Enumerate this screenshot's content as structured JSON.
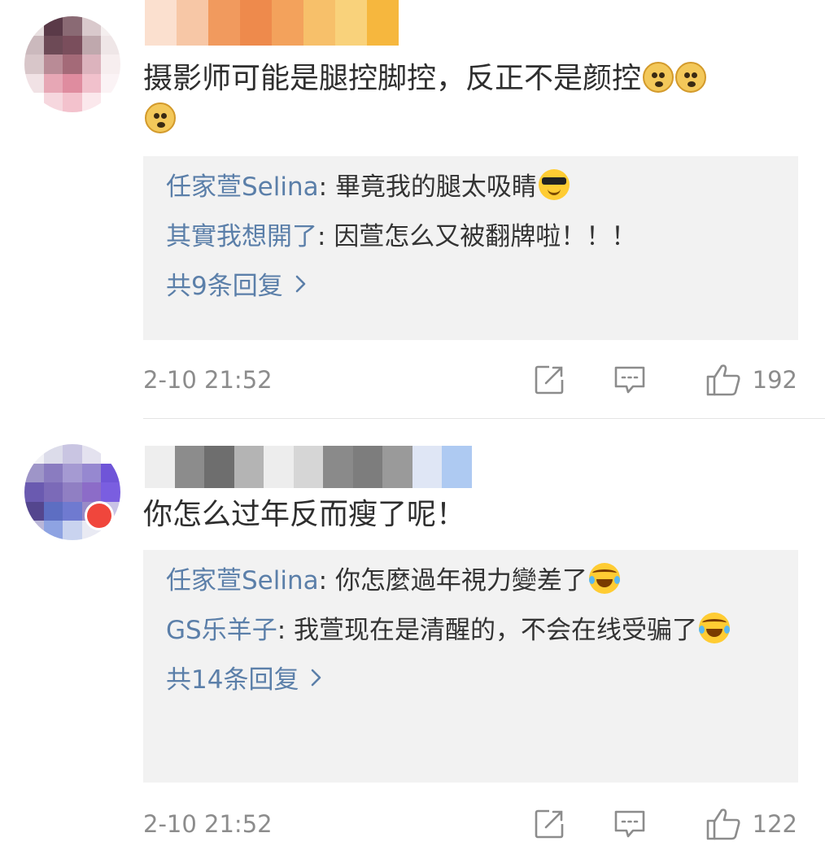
{
  "comments": [
    {
      "text": "摄影师可能是腿控脚控，反正不是颜控",
      "emoji_trailing": [
        "doge-emoji",
        "doge-emoji",
        "doge-emoji"
      ],
      "replies": [
        {
          "name": "任家萱Selina",
          "sep": ": ",
          "text": "畢竟我的腿太吸睛",
          "emoji": "cool-emoji"
        },
        {
          "name": "其實我想開了",
          "sep": ": ",
          "text": "因萱怎么又被翻牌啦！！！",
          "emoji": ""
        }
      ],
      "reply_count_label": "共9条回复",
      "timestamp": "2-10 21:52",
      "likes": "192"
    },
    {
      "text": "你怎么过年反而瘦了呢！",
      "emoji_trailing": [],
      "replies": [
        {
          "name": "任家萱Selina",
          "sep": ": ",
          "text": "你怎麼過年視力變差了",
          "emoji": "laugh-cry-emoji"
        },
        {
          "name": "GS乐羊子",
          "sep": ": ",
          "text": "我萱现在是清醒的，不会在线受骗了",
          "emoji": "laugh-cry-emoji"
        }
      ],
      "reply_count_label": "共14条回复",
      "timestamp": "2-10 21:52",
      "likes": "122"
    }
  ],
  "icons": {
    "forward": "forward-icon",
    "comment": "comment-icon",
    "like": "thumbs-up-icon",
    "chevron": "chevron-right-icon"
  },
  "colors": {
    "link": "#5b7fa9",
    "meta": "#8c8c8c",
    "reply_bg": "#f2f2f2"
  }
}
